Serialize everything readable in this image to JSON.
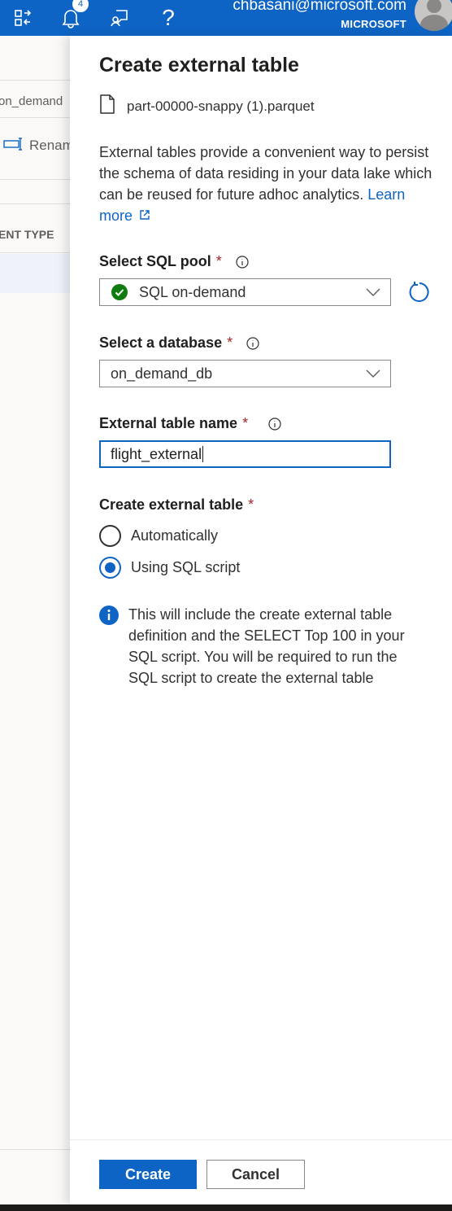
{
  "topbar": {
    "notification_count": "4",
    "user_email": "chbasani@microsoft.com",
    "user_org": "MICROSOFT",
    "icons": [
      "directory-switch-icon",
      "bell-icon",
      "feedback-icon",
      "help-icon",
      "avatar"
    ]
  },
  "background": {
    "row1": "on_demand",
    "row2": "Renam",
    "column_header": "ENT TYPE"
  },
  "panel": {
    "title": "Create external table",
    "file_name": "part-00000-snappy (1).parquet",
    "description": "External tables provide a convenient way to persist the schema of data residing in your data lake which can be reused for future adhoc analytics.",
    "learn_more": "Learn more",
    "sql_pool": {
      "label": "Select SQL pool",
      "required": "*",
      "value": "SQL on-demand",
      "status": "available"
    },
    "database": {
      "label": "Select a database",
      "required": "*",
      "value": "on_demand_db"
    },
    "table_name": {
      "label": "External table name",
      "required": "*",
      "value": "flight_external"
    },
    "create_method": {
      "label": "Create external table",
      "required": "*",
      "options": [
        "Automatically",
        "Using SQL script"
      ],
      "selected": "Using SQL script"
    },
    "info_note": "This will include the create external table definition and the SELECT Top 100 in your SQL script. You will be required to run the SQL script to create the external table",
    "buttons": {
      "create": "Create",
      "cancel": "Cancel"
    }
  },
  "colors": {
    "accent": "#0e64c4",
    "success": "#107c10",
    "required": "#a4262c"
  }
}
